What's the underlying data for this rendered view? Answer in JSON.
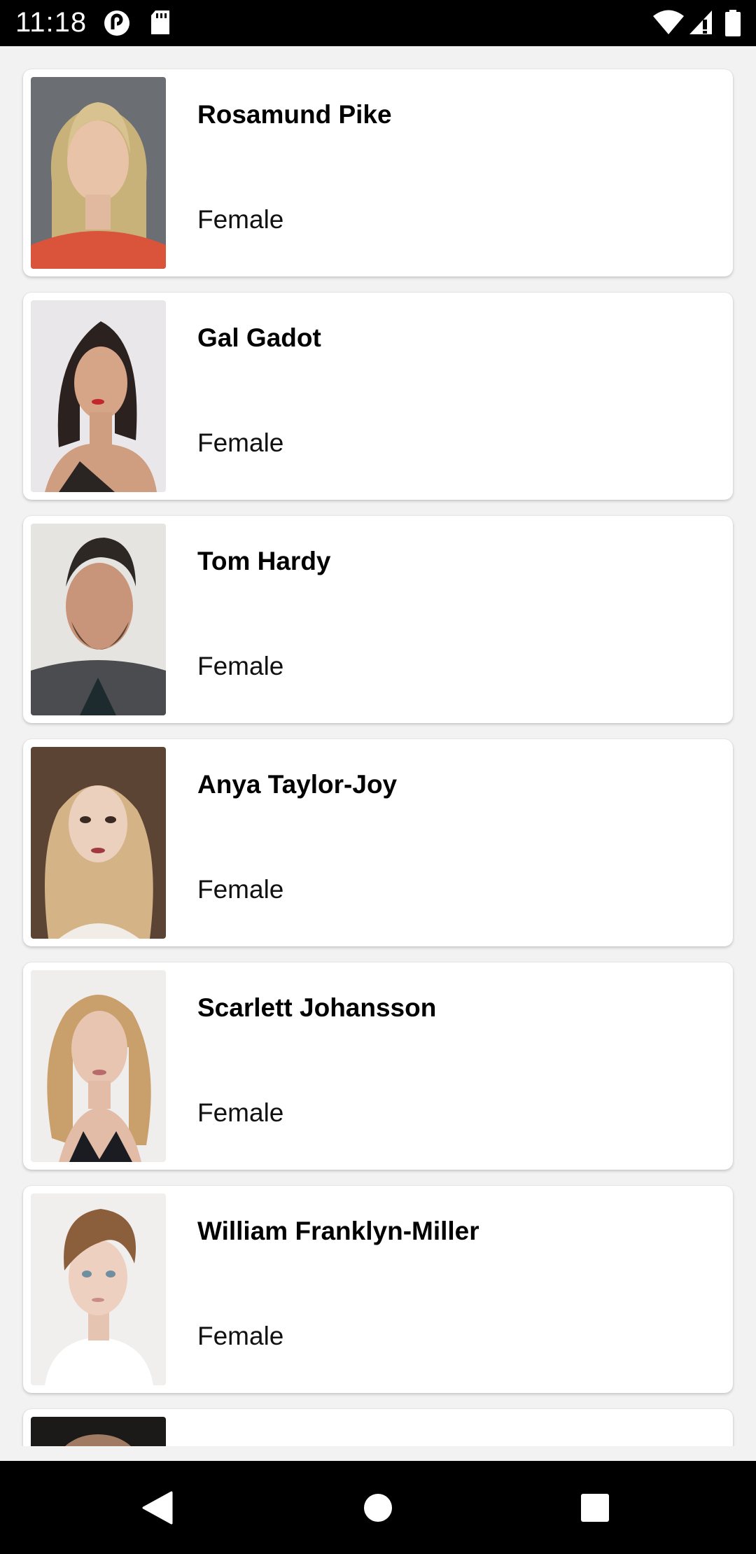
{
  "status_bar": {
    "time": "11:18",
    "icons": [
      "pocket-casts-icon",
      "sd-card-icon",
      "wifi-icon",
      "signal-icon",
      "battery-icon"
    ]
  },
  "people": [
    {
      "name": "Rosamund Pike",
      "gender": "Female",
      "photo": "portrait-blonde-woman"
    },
    {
      "name": "Gal Gadot",
      "gender": "Female",
      "photo": "portrait-dark-haired-woman"
    },
    {
      "name": "Tom Hardy",
      "gender": "Female",
      "photo": "portrait-bearded-man"
    },
    {
      "name": "Anya Taylor-Joy",
      "gender": "Female",
      "photo": "portrait-wavy-blonde-woman"
    },
    {
      "name": "Scarlett Johansson",
      "gender": "Female",
      "photo": "portrait-blonde-woman-black-top"
    },
    {
      "name": "William Franklyn-Miller",
      "gender": "Female",
      "photo": "portrait-young-boy"
    }
  ],
  "nav_bar": {
    "buttons": [
      "back-icon",
      "home-icon",
      "recents-icon"
    ]
  },
  "colors": {
    "background": "#f2f2f2",
    "card": "#ffffff",
    "status_bar": "#000000",
    "nav_bar": "#000000"
  }
}
